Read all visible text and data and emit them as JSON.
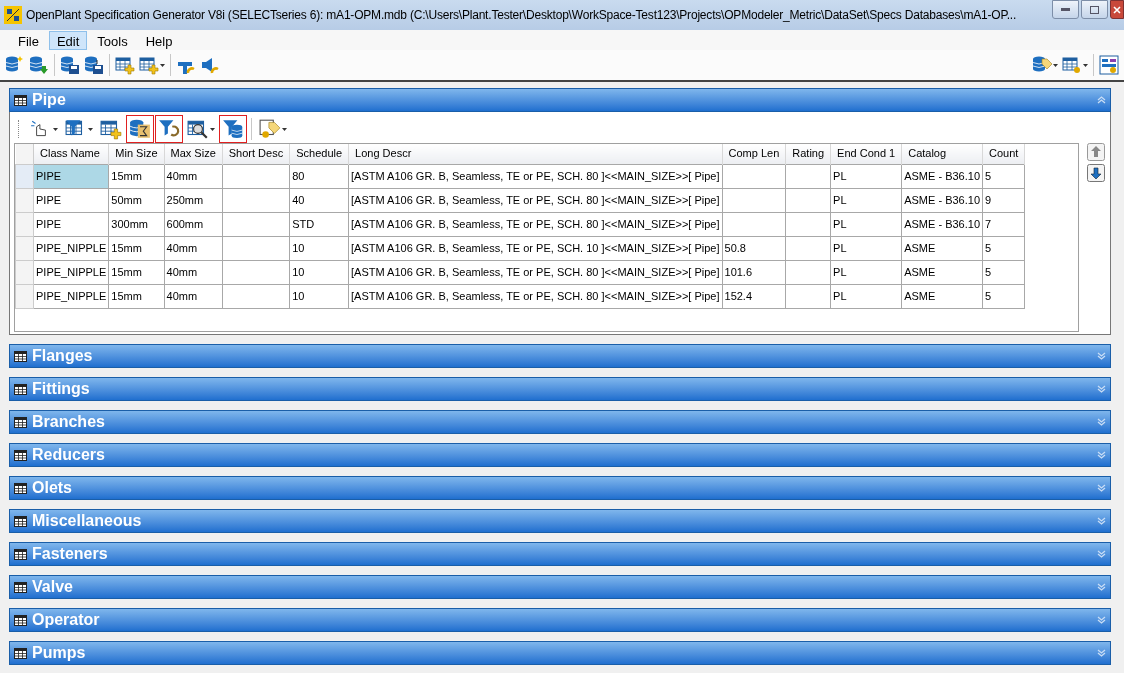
{
  "window": {
    "title": "OpenPlant Specification Generator V8i (SELECTseries 6): mA1-OPM.mdb (C:\\Users\\Plant.Tester\\Desktop\\WorkSpace-Test123\\Projects\\OPModeler_Metric\\DataSet\\Specs Databases\\mA1-OP..."
  },
  "menu": [
    {
      "label": "File",
      "selected": false
    },
    {
      "label": "Edit",
      "selected": true
    },
    {
      "label": "Tools",
      "selected": false
    },
    {
      "label": "Help",
      "selected": false
    }
  ],
  "panels": [
    {
      "title": "Pipe",
      "expanded": true,
      "toolbar": [
        {
          "kind": "pick",
          "dropdown": true,
          "highlighted": false
        },
        {
          "kind": "filter-grid",
          "dropdown": true,
          "highlighted": false
        },
        {
          "kind": "add-grid",
          "dropdown": false,
          "highlighted": false
        },
        {
          "kind": "sum-db",
          "dropdown": false,
          "highlighted": true
        },
        {
          "kind": "filter-refresh",
          "dropdown": false,
          "highlighted": true
        },
        {
          "kind": "find",
          "dropdown": true,
          "highlighted": false
        },
        {
          "kind": "filter-db",
          "dropdown": false,
          "highlighted": true
        },
        {
          "kind": "tag",
          "dropdown": true,
          "highlighted": false
        }
      ],
      "table": {
        "columns": [
          "Class Name",
          "Min Size",
          "Max Size",
          "Short Desc",
          "Schedule",
          "Long Descr",
          "Comp Len",
          "Rating",
          "End Cond 1",
          "Catalog",
          "Count"
        ],
        "rows": [
          {
            "cells": [
              "PIPE",
              "15mm",
              "40mm",
              "",
              "80",
              "[ASTM A106 GR. B, Seamless, TE or PE, SCH. 80 ]<<MAIN_SIZE>>[ Pipe]",
              "",
              "",
              "PL",
              "ASME - B36.10",
              "5"
            ],
            "selected": true
          },
          {
            "cells": [
              "PIPE",
              "50mm",
              "250mm",
              "",
              "40",
              "[ASTM A106 GR. B, Seamless, TE or PE, SCH. 80 ]<<MAIN_SIZE>>[ Pipe]",
              "",
              "",
              "PL",
              "ASME - B36.10",
              "9"
            ],
            "selected": false
          },
          {
            "cells": [
              "PIPE",
              "300mm",
              "600mm",
              "",
              "STD",
              "[ASTM A106 GR. B, Seamless, TE or PE, SCH. 80 ]<<MAIN_SIZE>>[ Pipe]",
              "",
              "",
              "PL",
              "ASME - B36.10",
              "7"
            ],
            "selected": false
          },
          {
            "cells": [
              "PIPE_NIPPLE",
              "15mm",
              "40mm",
              "",
              "10",
              "[ASTM A106 GR. B, Seamless, TE or PE, SCH. 10 ]<<MAIN_SIZE>>[ Pipe]",
              "50.8",
              "",
              "PL",
              "ASME",
              "5"
            ],
            "selected": false
          },
          {
            "cells": [
              "PIPE_NIPPLE",
              "15mm",
              "40mm",
              "",
              "10",
              "[ASTM A106 GR. B, Seamless, TE or PE, SCH. 80 ]<<MAIN_SIZE>>[ Pipe]",
              "101.6",
              "",
              "PL",
              "ASME",
              "5"
            ],
            "selected": false
          },
          {
            "cells": [
              "PIPE_NIPPLE",
              "15mm",
              "40mm",
              "",
              "10",
              "[ASTM A106 GR. B, Seamless, TE or PE, SCH. 80 ]<<MAIN_SIZE>>[ Pipe]",
              "152.4",
              "",
              "PL",
              "ASME",
              "5"
            ],
            "selected": false
          }
        ]
      }
    },
    {
      "title": "Flanges",
      "expanded": false
    },
    {
      "title": "Fittings",
      "expanded": false
    },
    {
      "title": "Branches",
      "expanded": false
    },
    {
      "title": "Reducers",
      "expanded": false
    },
    {
      "title": "Olets",
      "expanded": false
    },
    {
      "title": "Miscellaneous",
      "expanded": false
    },
    {
      "title": "Fasteners",
      "expanded": false
    },
    {
      "title": "Valve",
      "expanded": false
    },
    {
      "title": "Operator",
      "expanded": false
    },
    {
      "title": "Pumps",
      "expanded": false
    }
  ]
}
